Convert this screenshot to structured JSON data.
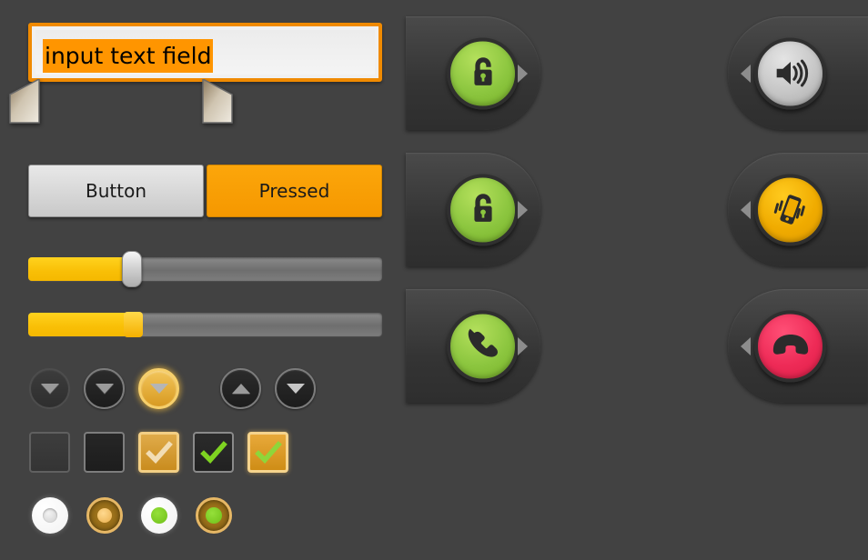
{
  "theme": {
    "background": "#424242",
    "accent_orange": "#ff9500",
    "accent_amber": "#f0ab00",
    "accent_green": "#8cc63f",
    "accent_pink": "#ee2b57",
    "text_dark": "#1a1a1a"
  },
  "text_field": {
    "name": "input-text-field",
    "value": "input text field",
    "placeholder": "input text field",
    "selected_text": "input text field",
    "focused": true,
    "selection_handles": [
      "left-selection-handle",
      "right-selection-handle"
    ]
  },
  "buttons": [
    {
      "label": "Button",
      "state": "normal",
      "name": "button-normal"
    },
    {
      "label": "Pressed",
      "state": "pressed",
      "name": "button-pressed"
    }
  ],
  "sliders": [
    {
      "name": "slider-silver-thumb",
      "value": 28,
      "min": 0,
      "max": 100,
      "thumb": "silver"
    },
    {
      "name": "slider-amber-thumb",
      "value": 28,
      "min": 0,
      "max": 100,
      "thumb": "amber"
    }
  ],
  "spinners": [
    {
      "name": "spinner-down-disabled",
      "icon": "chevron-down-icon",
      "direction": "down",
      "state": "disabled"
    },
    {
      "name": "spinner-down-normal",
      "icon": "chevron-down-icon",
      "direction": "down",
      "state": "normal"
    },
    {
      "name": "spinner-down-focused",
      "icon": "chevron-down-icon",
      "direction": "down",
      "state": "focused"
    },
    {
      "name": "spinner-up-normal",
      "icon": "chevron-up-icon",
      "direction": "up",
      "state": "normal"
    },
    {
      "name": "spinner-down-normal-2",
      "icon": "chevron-down-icon",
      "direction": "down",
      "state": "normal"
    }
  ],
  "checkboxes": [
    {
      "name": "checkbox-unchecked-disabled",
      "checked": false,
      "state": "disabled"
    },
    {
      "name": "checkbox-unchecked",
      "checked": false,
      "state": "normal"
    },
    {
      "name": "checkbox-checked-disabled",
      "checked": true,
      "state": "focused-disabled"
    },
    {
      "name": "checkbox-checked",
      "checked": true,
      "state": "normal"
    },
    {
      "name": "checkbox-checked-focused",
      "checked": true,
      "state": "focused"
    }
  ],
  "radios": [
    {
      "name": "radio-unselected",
      "selected": false,
      "state": "normal"
    },
    {
      "name": "radio-unselected-focused",
      "selected": false,
      "state": "focused"
    },
    {
      "name": "radio-selected",
      "selected": true,
      "state": "normal"
    },
    {
      "name": "radio-selected-focused",
      "selected": true,
      "state": "focused"
    }
  ],
  "slide_actions": [
    {
      "name": "slide-to-unlock",
      "icon": "unlock-icon",
      "side": "left",
      "arrow": "arrow-right-icon",
      "circle_color": "#8cc63f"
    },
    {
      "name": "slide-to-unlock-2",
      "icon": "unlock-icon",
      "side": "left",
      "arrow": "arrow-right-icon",
      "circle_color": "#8cc63f"
    },
    {
      "name": "slide-to-answer",
      "icon": "phone-answer-icon",
      "side": "left",
      "arrow": "arrow-right-icon",
      "circle_color": "#8cc63f"
    },
    {
      "name": "slide-to-sound",
      "icon": "speaker-icon",
      "side": "right",
      "arrow": "arrow-left-icon",
      "circle_color": "#c6c6c6"
    },
    {
      "name": "slide-to-vibrate",
      "icon": "vibrate-icon",
      "side": "right",
      "arrow": "arrow-left-icon",
      "circle_color": "#f0ab00"
    },
    {
      "name": "slide-to-decline",
      "icon": "phone-hangup-icon",
      "side": "right",
      "arrow": "arrow-left-icon",
      "circle_color": "#ee2b57"
    }
  ]
}
